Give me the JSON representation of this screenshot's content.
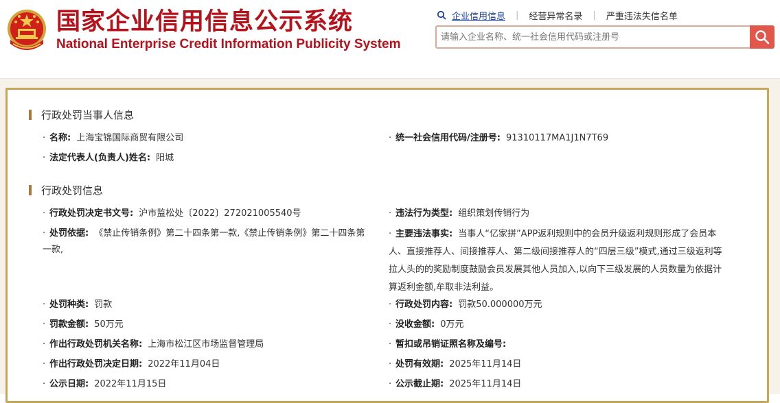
{
  "header": {
    "title_cn": "国家企业信用信息公示系统",
    "title_en": "National Enterprise Credit Information Publicity System"
  },
  "nav": {
    "items": [
      "企业信用信息",
      "经营异常名录",
      "严重违法失信名单"
    ],
    "active_index": 0
  },
  "search": {
    "placeholder": "请输入企业名称、统一社会信用代码或注册号",
    "value": ""
  },
  "section1": {
    "title": "行政处罚当事人信息",
    "name_label": "名称:",
    "name_value": "上海宝锦国际商贸有限公司",
    "code_label": "统一社会信用代码/注册号:",
    "code_value": "91310117MA1J1N7T69",
    "rep_label": "法定代表人(负责人)姓名:",
    "rep_value": "阳城"
  },
  "section2": {
    "title": "行政处罚信息",
    "doc_label": "行政处罚决定书文号:",
    "doc_value": "沪市监松处〔2022〕272021005540号",
    "type_label": "违法行为类型:",
    "type_value": "组织策划传销行为",
    "basis_label": "处罚依据:",
    "basis_value": "《禁止传销条例》第二十四条第一款,《禁止传销条例》第二十四条第一款,",
    "facts_label": "主要违法事实:",
    "facts_value": "当事人“亿家拼”APP返利规则中的会员升级返利规则形成了会员本人、直接推荐人、间接推荐人、第二级间接推荐人的“四层三级”模式,通过三级返利等拉人头的的奖励制度鼓励会员发展其他人员加入,以向下三级发展的人员数量为依据计算返利金额,牟取非法利益。",
    "kind_label": "处罚种类:",
    "kind_value": "罚款",
    "content_label": "行政处罚内容:",
    "content_value": "罚款50.000000万元",
    "fine_label": "罚款金额:",
    "fine_value": "50万元",
    "confiscate_label": "没收金额:",
    "confiscate_value": "0万元",
    "authority_label": "作出行政处罚机关名称:",
    "authority_value": "上海市松江区市场监督管理局",
    "license_label": "暂扣或吊销证照名称及编号:",
    "license_value": "",
    "decision_date_label": "作出行政处罚决定日期:",
    "decision_date_value": "2022年11月04日",
    "valid_label": "处罚有效期:",
    "valid_value": "2025年11月14日",
    "publish_label": "公示日期:",
    "publish_value": "2022年11月15日",
    "publish_end_label": "公示截止期:",
    "publish_end_value": "2025年11月14日"
  },
  "colors": {
    "brand_red": "#b5121b",
    "search_button": "#e2574b",
    "panel_border": "#c9a55a",
    "section_bar": "#a57a3a",
    "link_blue": "#1c3fa6"
  }
}
